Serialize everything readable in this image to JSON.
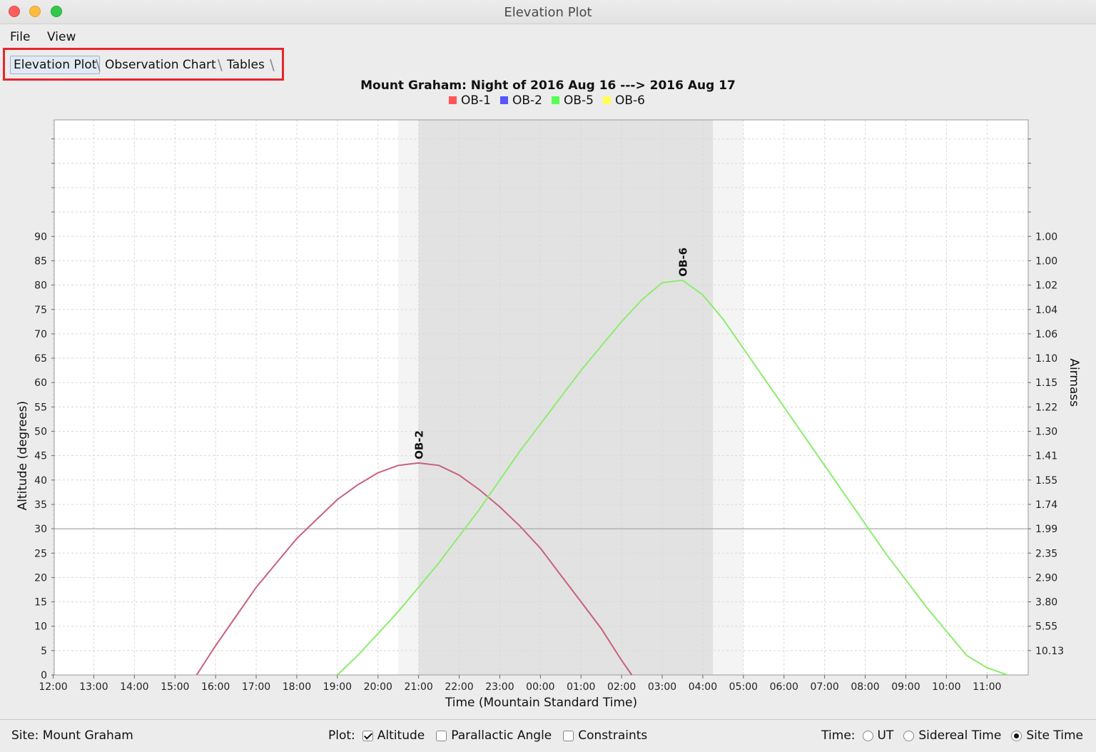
{
  "window": {
    "title": "Elevation Plot"
  },
  "menubar": {
    "items": [
      "File",
      "View"
    ]
  },
  "tabs": [
    {
      "label": "Elevation Plot",
      "active": true
    },
    {
      "label": "Observation Chart",
      "active": false
    },
    {
      "label": "Tables",
      "active": false
    }
  ],
  "status": {
    "site_label": "Site:",
    "site_value": "Mount Graham",
    "plot_label": "Plot:",
    "plot_options": [
      {
        "label": "Altitude",
        "checked": true
      },
      {
        "label": "Parallactic Angle",
        "checked": false
      },
      {
        "label": "Constraints",
        "checked": false
      }
    ],
    "time_label": "Time:",
    "time_options": [
      {
        "label": "UT",
        "selected": false
      },
      {
        "label": "Sidereal Time",
        "selected": false
      },
      {
        "label": "Site Time",
        "selected": true
      }
    ]
  },
  "colors": {
    "OB-1": "#ff5555",
    "OB-2": "#5555ff",
    "OB-5": "#55ff55",
    "OB-6": "#ffff55",
    "curve_ob2": "#c8607a",
    "curve_ob6": "#8cec6c",
    "highlight": "#e8262a"
  },
  "chart_data": {
    "type": "line",
    "title": "Mount Graham: Night of 2016 Aug 16 ---> 2016 Aug 17",
    "legend": [
      "OB-1",
      "OB-2",
      "OB-5",
      "OB-6"
    ],
    "legend_position": "top-center",
    "xlabel": "Time (Mountain Standard Time)",
    "ylabel": "Altitude (degrees)",
    "y2label": "Airmass",
    "x_ticks": [
      "13:00",
      "14:00",
      "15:00",
      "16:00",
      "17:00",
      "18:00",
      "19:00",
      "20:00",
      "21:00",
      "22:00",
      "23:00",
      "00:00",
      "01:00",
      "02:00",
      "03:00",
      "04:00",
      "05:00",
      "06:00",
      "07:00",
      "08:00",
      "09:00",
      "10:00",
      "11:00",
      "12:00"
    ],
    "y_ticks": [
      0,
      5,
      10,
      15,
      20,
      25,
      30,
      35,
      40,
      45,
      50,
      55,
      60,
      65,
      70,
      75,
      80,
      85,
      90
    ],
    "airmass_ticks": [
      "10.13",
      "5.55",
      "3.80",
      "2.90",
      "2.35",
      "1.99",
      "1.74",
      "1.55",
      "1.41",
      "1.30",
      "1.22",
      "1.15",
      "1.10",
      "1.06",
      "1.04",
      "1.02",
      "1.00",
      "1.00"
    ],
    "ylim": [
      0,
      90
    ],
    "reference_line_y": 30,
    "twilight_bands": [
      {
        "from": "20:30",
        "to": "05:00",
        "shade": "twilight"
      },
      {
        "from": "21:00",
        "to": "04:15",
        "shade": "night"
      }
    ],
    "series": [
      {
        "name": "OB-2",
        "label": "OB-2",
        "x": [
          "15:32",
          "16:00",
          "16:30",
          "17:00",
          "17:30",
          "18:00",
          "18:30",
          "19:00",
          "19:30",
          "20:00",
          "20:30",
          "21:00",
          "21:30",
          "22:00",
          "22:30",
          "23:00",
          "23:30",
          "00:00",
          "00:30",
          "01:00",
          "01:30",
          "02:00",
          "02:15"
        ],
        "y": [
          0,
          6,
          12,
          18,
          23,
          28,
          32,
          36,
          39,
          41.5,
          43,
          43.5,
          43,
          41,
          38,
          34.5,
          30.5,
          26,
          20.5,
          15,
          9.5,
          3,
          0
        ]
      },
      {
        "name": "OB-6",
        "label": "OB-6",
        "x": [
          "19:00",
          "19:30",
          "20:00",
          "20:30",
          "21:00",
          "21:30",
          "22:00",
          "22:30",
          "23:00",
          "23:30",
          "00:00",
          "00:30",
          "01:00",
          "01:30",
          "02:00",
          "02:30",
          "03:00",
          "03:30",
          "04:00",
          "04:30",
          "05:00",
          "05:30",
          "06:00",
          "06:30",
          "07:00",
          "07:30",
          "08:00",
          "08:30",
          "09:00",
          "09:30",
          "10:00",
          "10:30",
          "11:00",
          "11:30"
        ],
        "y": [
          0,
          4,
          8.5,
          13,
          18,
          23,
          28.5,
          34,
          40,
          46,
          51.5,
          57,
          62.5,
          67.5,
          72.5,
          77,
          80.5,
          81,
          78,
          73,
          67,
          61,
          55,
          49,
          43,
          37,
          31,
          25,
          19.5,
          14,
          9,
          4,
          1.5,
          0
        ]
      }
    ]
  }
}
